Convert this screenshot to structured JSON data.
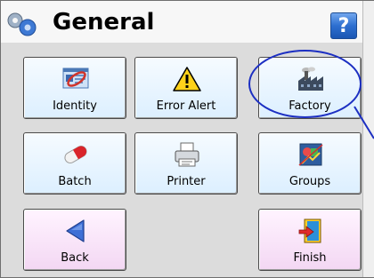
{
  "header": {
    "title": "General",
    "help_label": "?"
  },
  "tiles": [
    {
      "label": "Identity",
      "icon": "identity-card-icon"
    },
    {
      "label": "Error Alert",
      "icon": "warning-icon"
    },
    {
      "label": "Factory",
      "icon": "factory-icon"
    },
    {
      "label": "Batch",
      "icon": "batch-pill-icon"
    },
    {
      "label": "Printer",
      "icon": "printer-icon"
    },
    {
      "label": "Groups",
      "icon": "groups-icon"
    },
    {
      "label": "Back",
      "icon": "back-arrow-icon"
    },
    {
      "label": "Finish",
      "icon": "finish-door-icon"
    }
  ],
  "colors": {
    "tile_blue": "#dcefff",
    "tile_pink": "#f3d7f3",
    "content_bg": "#dcdcdc",
    "help_button": "#2d6fd0",
    "highlight_ring": "#1c2fc2"
  }
}
